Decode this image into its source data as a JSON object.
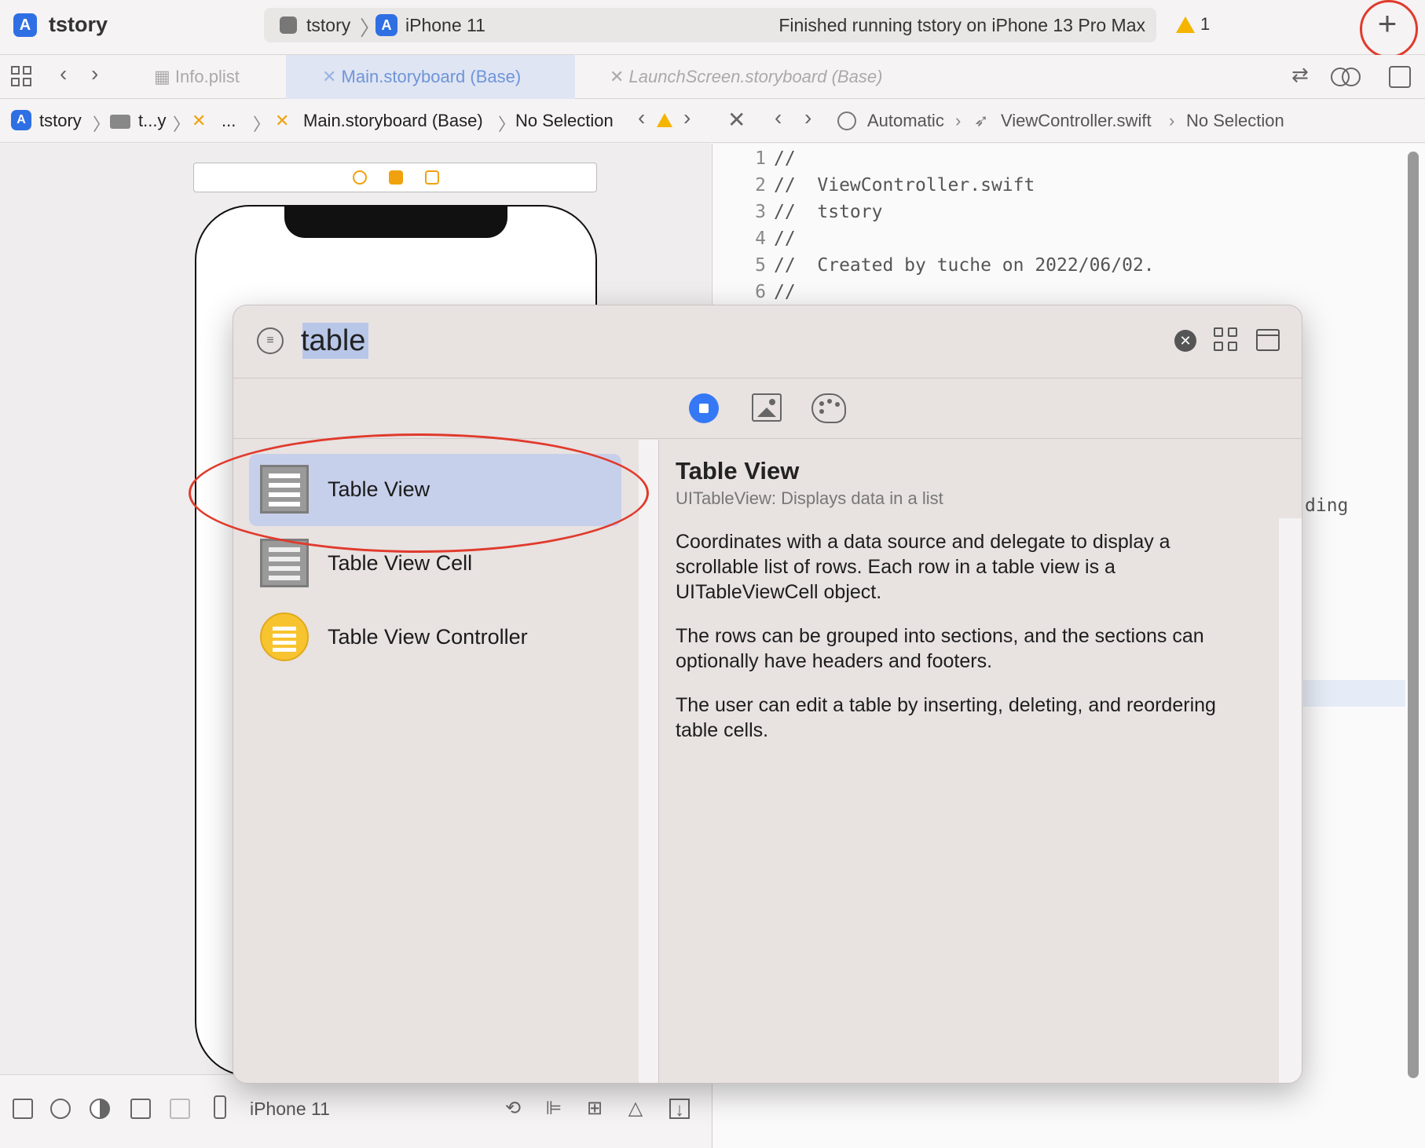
{
  "toolbar": {
    "app_title": "tstory",
    "scheme": "tstory",
    "destination": "iPhone 11",
    "status": "Finished running tstory on iPhone 13 Pro Max",
    "warning_count": "1",
    "plus_label": "+"
  },
  "tabs": [
    {
      "label": "Info.plist"
    },
    {
      "label": "Main.storyboard (Base)"
    },
    {
      "label": "LaunchScreen.storyboard (Base)"
    }
  ],
  "jumpbar_left": {
    "project": "tstory",
    "folder": "t...y",
    "ellipsis": "...",
    "file": "Main.storyboard (Base)",
    "selection": "No Selection"
  },
  "jumpbar_right": {
    "mode": "Automatic",
    "file": "ViewController.swift",
    "selection": "No Selection"
  },
  "code": {
    "lines": [
      {
        "n": "1",
        "text": "//"
      },
      {
        "n": "2",
        "text": "//  ViewController.swift"
      },
      {
        "n": "3",
        "text": "//  tstory"
      },
      {
        "n": "4",
        "text": "//"
      },
      {
        "n": "5",
        "text": "//  Created by tuche on 2022/06/02."
      },
      {
        "n": "6",
        "text": "//"
      }
    ],
    "fragment": "ding"
  },
  "bottombar": {
    "device": "iPhone 11"
  },
  "library": {
    "search_value": "table",
    "items": [
      {
        "label": "Table View"
      },
      {
        "label": "Table View Cell"
      },
      {
        "label": "Table View Controller"
      }
    ],
    "detail": {
      "title": "Table View",
      "subtitle": "UITableView: Displays data in a list",
      "paragraphs": [
        "Coordinates with a data source and delegate to display a scrollable list of rows. Each row in a table view is a UITableViewCell object.",
        "The rows can be grouped into sections, and the sections can optionally have headers and footers.",
        "The user can edit a table by inserting, deleting, and reordering table cells."
      ]
    }
  },
  "colors": {
    "accent": "#3478f6",
    "annotation_red": "#e03a2c",
    "selection": "#c7d0ea",
    "warning": "#f4b400"
  }
}
